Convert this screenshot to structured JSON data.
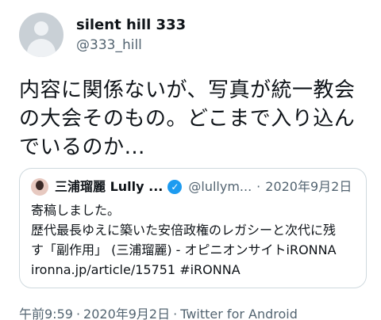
{
  "author": {
    "display_name": "silent hill 333",
    "handle": "@333_hill"
  },
  "tweet": {
    "lines": [
      "内容に関係ないが、写真が統一教会",
      "の大会そのもの。どこまで入り込ん",
      "でいるのか…"
    ]
  },
  "quoted": {
    "display_name": "三浦瑠麗 Lully ...",
    "verified_mark": "✓",
    "handle": "@lullym...",
    "separator": "·",
    "date": "2020年9月2日",
    "lines": [
      "寄稿しました。",
      "歴代最長ゆえに築いた安倍政権のレガシーと次代に残",
      "す「副作用」 (三浦瑠麗) - オピニオンサイトiRONNA",
      "ironna.jp/article/15751 #iRONNA"
    ]
  },
  "meta": {
    "time": "午前9:59",
    "separator": "·",
    "date": "2020年9月2日",
    "source": "Twitter for Android"
  },
  "colors": {
    "text": "#0f1419",
    "secondary": "#536471",
    "verified": "#1d9bf0",
    "border": "#cfd9de"
  }
}
